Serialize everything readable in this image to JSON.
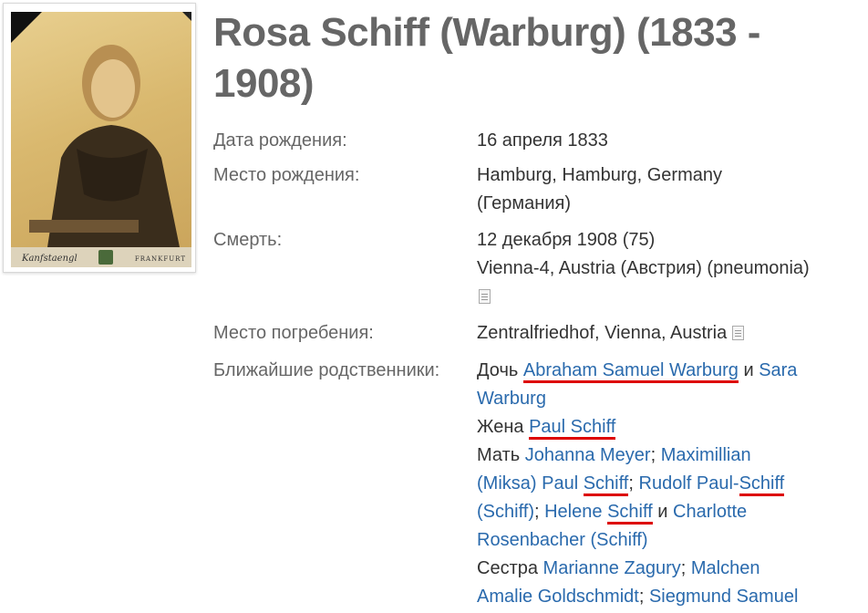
{
  "profile": {
    "name_title": "Rosa Schiff (Warburg) (1833 - 1908)",
    "photo": {
      "signature_text": "Kanfstaengl",
      "city_text": "FRANKFURT"
    }
  },
  "facts": {
    "birth_date": {
      "label": "Дата рождения:",
      "value": "16 апреля 1833"
    },
    "birth_place": {
      "label": "Место рождения:",
      "value": "Hamburg, Hamburg, Germany (Германия)"
    },
    "death": {
      "label": "Смерть:",
      "value_line1": "12 декабря 1908 (75)",
      "value_line2": "Vienna-4, Austria (Австрия) (pneumonia)"
    },
    "burial": {
      "label": "Место погребения:",
      "value": "Zentralfriedhof, Vienna, Austria"
    },
    "relatives": {
      "label": "Ближайшие родственники:"
    }
  },
  "relatives": {
    "daughter_prefix": "Дочь",
    "father": "Abraham Samuel Warburg",
    "and1": "и",
    "mother_link_part1": "Sara",
    "mother_link_part2": "Warburg",
    "wife_prefix": "Жена",
    "husband": "Paul Schiff",
    "mother_prefix": "Мать",
    "child1": "Johanna Meyer",
    "sep1": ";",
    "child2_part1": "Maximillian",
    "child2_part2": "(Miksa) Paul",
    "child2_surname": "Schiff",
    "sep2": ";",
    "child3_first": "Rudolf Paul-",
    "child3_surname": "Schiff",
    "child3_paren": "(Schiff)",
    "sep3": ";",
    "child4_first": "Helene",
    "child4_surname": "Schiff",
    "and2": "и",
    "child5_part1": "Charlotte",
    "child5_part2": "Rosenbacher (Schiff)",
    "sister_prefix": "Сестра",
    "sibling1": "Marianne Zagury",
    "sep4": ";",
    "sibling2_part1": "Malchen",
    "sibling2_part2": "Amalie Goldschmidt",
    "sep5": ";",
    "sibling3": "Siegmund Samuel"
  },
  "colors": {
    "link": "#2a6aad",
    "title": "#666666",
    "label": "#666666",
    "annotation_red": "#dd0000"
  }
}
